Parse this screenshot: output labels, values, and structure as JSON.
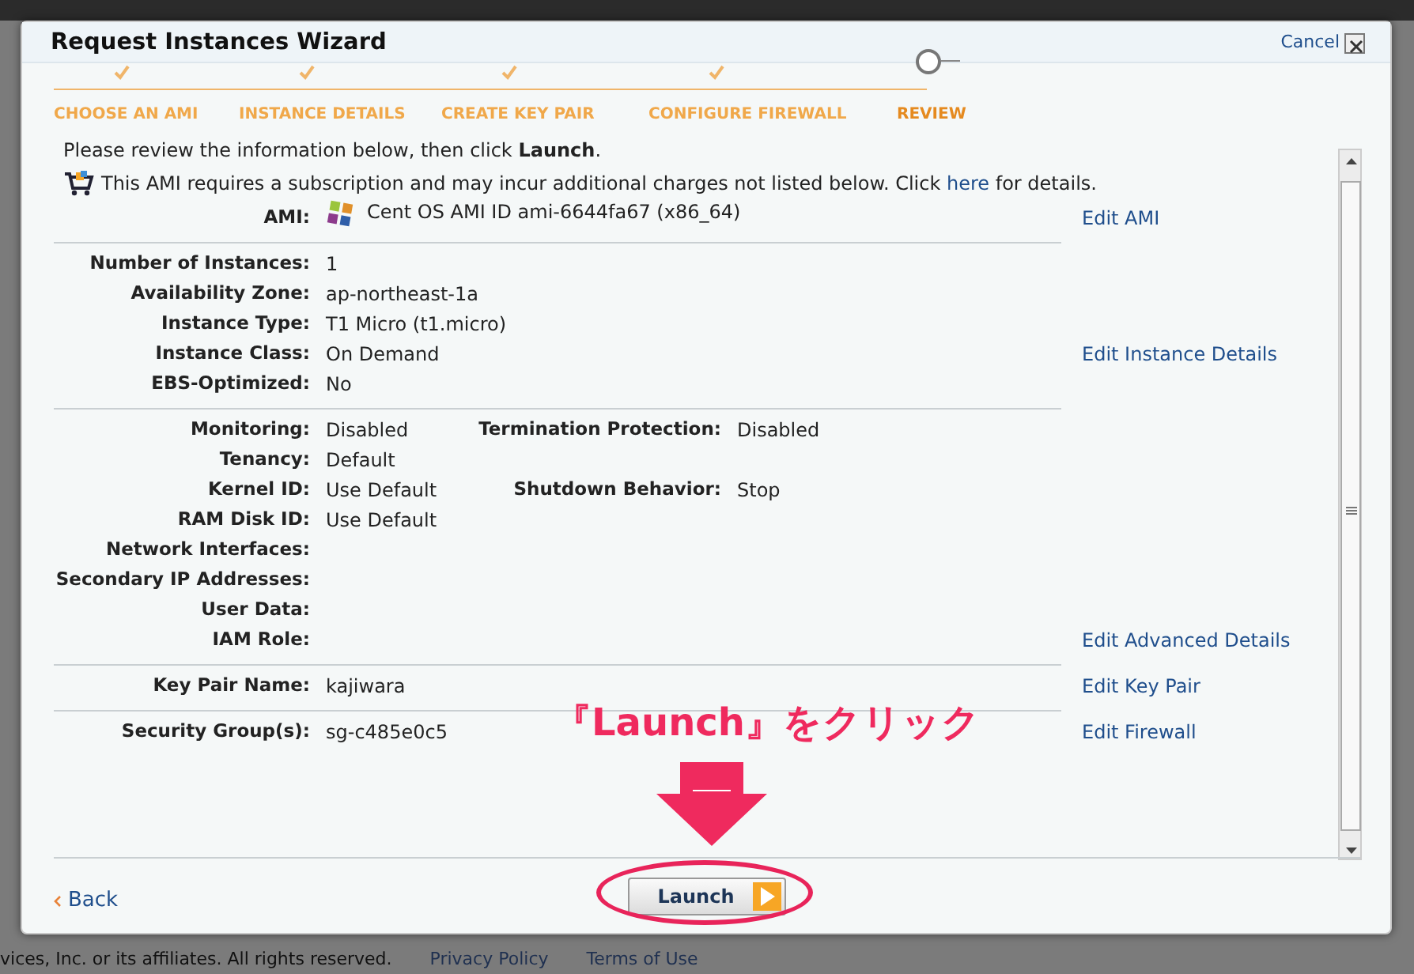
{
  "dialog": {
    "title": "Request Instances Wizard",
    "cancel": "Cancel"
  },
  "steps": [
    {
      "label": "CHOOSE AN AMI",
      "completed": true,
      "selected": false
    },
    {
      "label": "INSTANCE DETAILS",
      "completed": true,
      "selected": false
    },
    {
      "label": "CREATE KEY PAIR",
      "completed": true,
      "selected": false
    },
    {
      "label": "CONFIGURE FIREWALL",
      "completed": true,
      "selected": false
    },
    {
      "label": "REVIEW",
      "completed": false,
      "selected": true
    }
  ],
  "intro": "Please review the information below, then click **Launch**.",
  "notice": {
    "before": "This AMI requires a subscription and may incur additional charges not listed below. Click",
    "link": "here",
    "after": "for details."
  },
  "sections": [
    {
      "rows": [
        {
          "label": "AMI:",
          "value": "Cent OS AMI ID ami-6644fa67 (x86_64)",
          "kind": "ami",
          "edit": "Edit AMI"
        }
      ]
    },
    {
      "rows": [
        {
          "label": "Number of Instances:",
          "value": "1"
        },
        {
          "label": "Availability Zone:",
          "value": "ap-northeast-1a"
        },
        {
          "label": "Instance Type:",
          "value": "T1 Micro (t1.micro)"
        },
        {
          "label": "Instance Class:",
          "value": "On Demand",
          "edit": "Edit Instance Details"
        },
        {
          "label": "EBS-Optimized:",
          "value": "No"
        }
      ]
    },
    {
      "rows": [
        {
          "label": "Monitoring:",
          "value": "Disabled",
          "label2": "Termination Protection:",
          "value2": "Disabled"
        },
        {
          "label": "Tenancy:",
          "value": "Default"
        },
        {
          "label": "Kernel ID:",
          "value": "Use Default",
          "label2": "Shutdown Behavior:",
          "value2": "Stop"
        },
        {
          "label": "RAM Disk ID:",
          "value": "Use Default"
        },
        {
          "label": "Network Interfaces:"
        },
        {
          "label": "Secondary IP Addresses:"
        },
        {
          "label": "User Data:"
        },
        {
          "label": "IAM Role:",
          "edit": "Edit Advanced Details"
        }
      ]
    },
    {
      "rows": [
        {
          "label": "Key Pair Name:",
          "value": "kajiwara",
          "edit": "Edit Key Pair"
        }
      ]
    },
    {
      "rows": [
        {
          "label": "Security Group(s):",
          "value": "sg-c485e0c5",
          "edit": "Edit Firewall"
        }
      ]
    }
  ],
  "back": "Back",
  "launch": "Launch",
  "annotation": {
    "text": "『Launch』をクリック"
  },
  "footer": {
    "copyright": "vices, Inc. or its affiliates. All rights reserved.",
    "links": [
      "Privacy Policy",
      "Terms of Use"
    ]
  }
}
